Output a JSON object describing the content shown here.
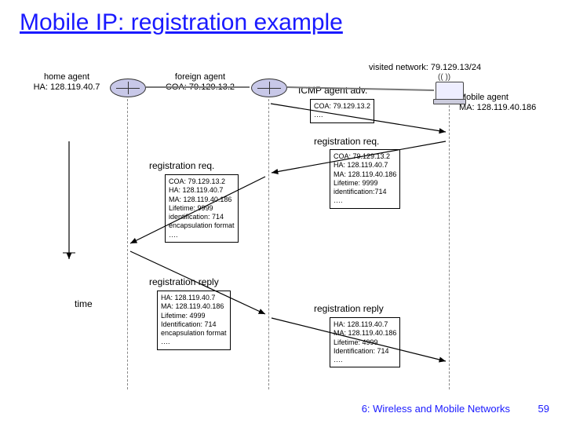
{
  "title": "Mobile IP: registration example",
  "visited_network": "visited network: 79.129.13/24",
  "home_agent": {
    "name": "home agent",
    "addr": "HA: 128.119.40.7"
  },
  "foreign_agent": {
    "name": "foreign agent",
    "addr": "COA: 79.129.13.2"
  },
  "mobile_agent": {
    "name": "Mobile agent",
    "addr": "MA: 128.119.40.186"
  },
  "icmp_label": "ICMP agent adv.",
  "icmp_box": "COA: 79.129.13.2\n….",
  "reg_req_label": "registration req.",
  "reg_req1": "COA: 79.129.13.2\nHA: 128.119.40.7\nMA: 128.119.40.186\nLifetime: 9999\nidentification:714\n….",
  "reg_req2": "COA: 79.129.13.2\nHA: 128.119.40.7\nMA: 128.119.40.186\nLifetime: 9999\nidentification: 714\nencapsulation format\n….",
  "reg_reply_label": "registration reply",
  "reg_reply1": "HA: 128.119.40.7\nMA: 128.119.40.186\nLifetime: 4999\nIdentification: 714\nencapsulation format\n….",
  "reg_reply2": "HA: 128.119.40.7\nMA: 128.119.40.186\nLifetime: 4999\nIdentification: 714\n….",
  "time_label": "time",
  "footer_chapter": "6: Wireless and Mobile Networks",
  "footer_page": "59"
}
